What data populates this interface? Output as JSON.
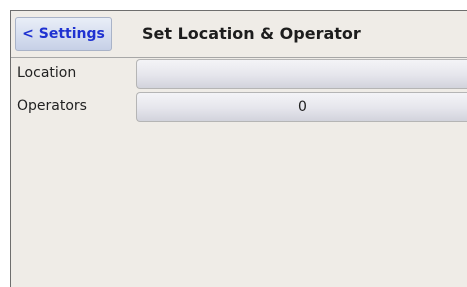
{
  "header": {
    "back_label": "< Settings",
    "title": "Set Location & Operator"
  },
  "rows": [
    {
      "label": "Location",
      "value": ""
    },
    {
      "label": "Operators",
      "value": "0"
    }
  ],
  "colors": {
    "background": "#efece7",
    "back_text": "#1f32d1",
    "field_top": "#f4f4f7",
    "field_bottom": "#d2d3dc"
  }
}
